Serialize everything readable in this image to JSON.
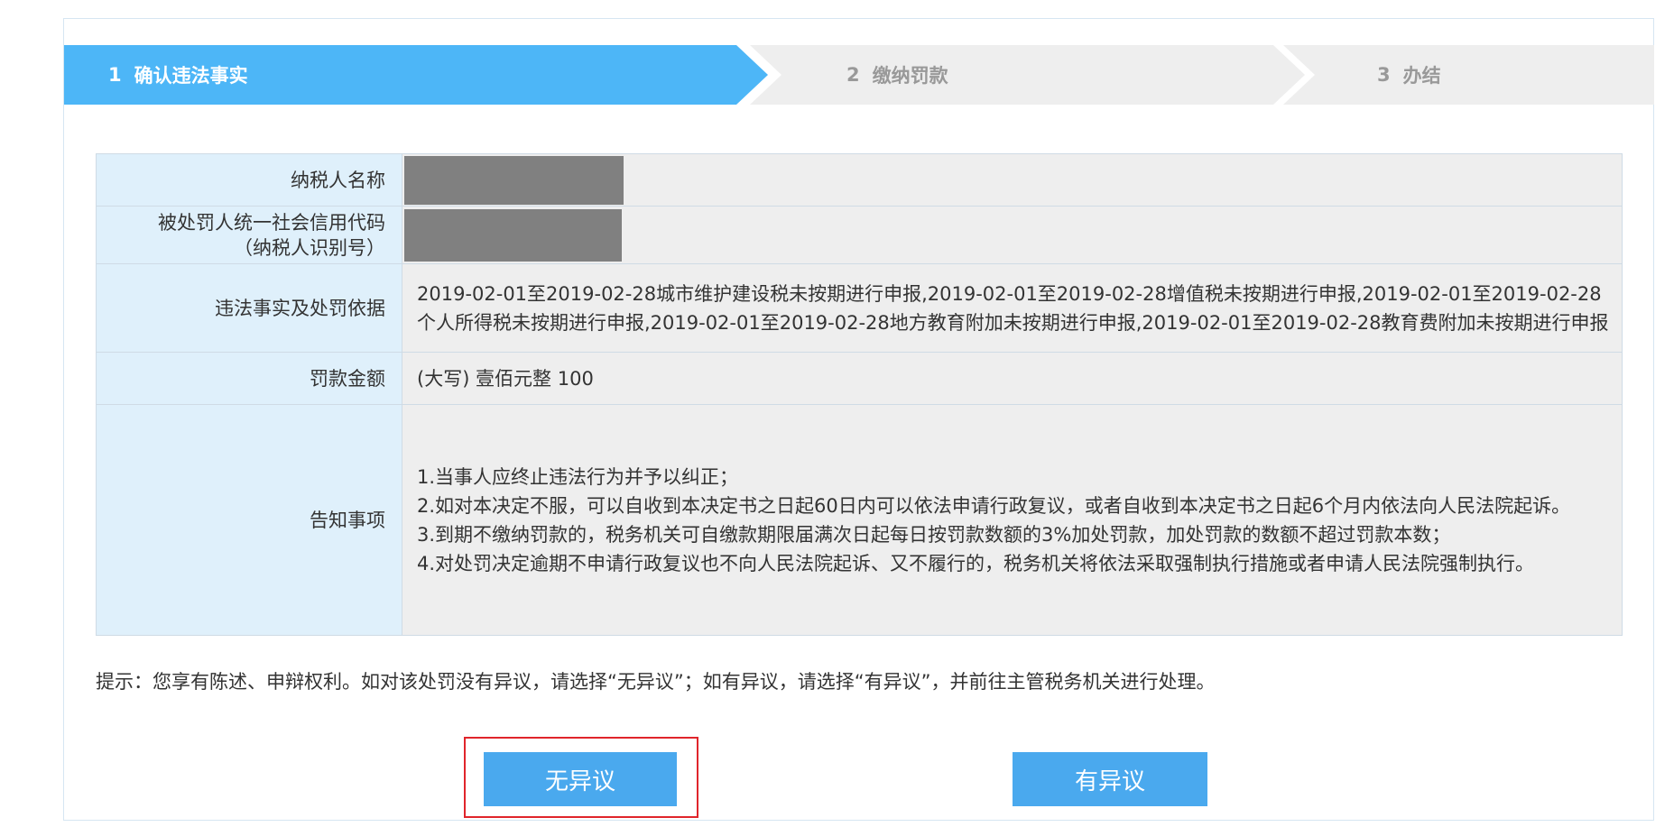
{
  "steps": [
    {
      "num": "1",
      "label": "确认违法事实"
    },
    {
      "num": "2",
      "label": "缴纳罚款"
    },
    {
      "num": "3",
      "label": "办结"
    }
  ],
  "table": {
    "taxpayer_name_label": "纳税人名称",
    "credit_code_label_line1": "被处罚人统一社会信用代码",
    "credit_code_label_line2": "（纳税人识别号）",
    "facts_label": "违法事实及处罚依据",
    "facts_value": "2019-02-01至2019-02-28城市维护建设税未按期进行申报,2019-02-01至2019-02-28增值税未按期进行申报,2019-02-01至2019-02-28个人所得税未按期进行申报,2019-02-01至2019-02-28地方教育附加未按期进行申报,2019-02-01至2019-02-28教育费附加未按期进行申报",
    "fine_label": "罚款金额",
    "fine_value": "(大写) 壹佰元整 100",
    "notice_label": "告知事项",
    "notice_items": [
      "1.当事人应终止违法行为并予以纠正；",
      "2.如对本决定不服，可以自收到本决定书之日起60日内可以依法申请行政复议，或者自收到本决定书之日起6个月内依法向人民法院起诉。",
      "3.到期不缴纳罚款的，税务机关可自缴款期限届满次日起每日按罚款数额的3%加处罚款，加处罚款的数额不超过罚款本数；",
      "4.对处罚决定逾期不申请行政复议也不向人民法院起诉、又不履行的，税务机关将依法采取强制执行措施或者申请人民法院强制执行。"
    ]
  },
  "tip": "提示：您享有陈述、申辩权利。如对该处罚没有异议，请选择“无异议”；如有异议，请选择“有异议”，并前往主管税务机关进行处理。",
  "buttons": {
    "no_objection": "无异议",
    "objection": "有异议"
  },
  "colors": {
    "active_step": "#4db6f7",
    "button": "#4aa9ee",
    "label_bg": "#dff0fb",
    "highlight": "#e0252b"
  }
}
